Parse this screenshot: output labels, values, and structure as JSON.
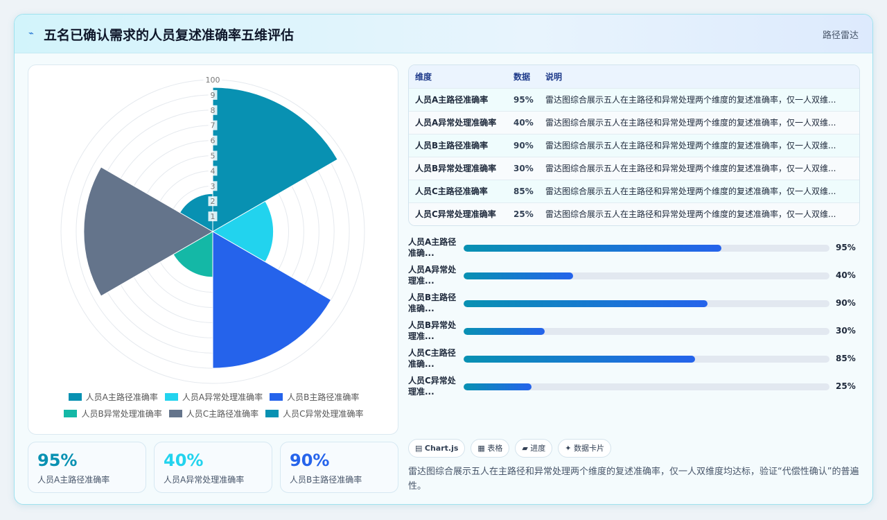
{
  "header": {
    "icon": "chart-icon",
    "title": "五名已确认需求的人员复述准确率五维评估",
    "tag": "路径雷达"
  },
  "chart_data": {
    "type": "polar-area",
    "title": "",
    "categories": [
      "人员A主路径准确率",
      "人员A异常处理准确率",
      "人员B主路径准确率",
      "人员B异常处理准确率",
      "人员C主路径准确率",
      "人员C异常处理准确率"
    ],
    "values": [
      95,
      40,
      90,
      30,
      85,
      25
    ],
    "colors": [
      "#0891b2",
      "#22d3ee",
      "#2563eb",
      "#14b8a6",
      "#64748b",
      "#0891b2"
    ],
    "rlim": [
      0,
      100
    ],
    "ticks": [
      10,
      20,
      30,
      40,
      50,
      60,
      70,
      80,
      90,
      100
    ],
    "tick_labels": [
      "1",
      "2",
      "3",
      "4",
      "5",
      "6",
      "7",
      "8",
      "9",
      "100"
    ],
    "legend_position": "bottom",
    "grid": true
  },
  "kpis": [
    {
      "value": "95%",
      "label": "人员A主路径准确率",
      "color": "#0891b2"
    },
    {
      "value": "40%",
      "label": "人员A异常处理准确率",
      "color": "#22d3ee"
    },
    {
      "value": "90%",
      "label": "人员B主路径准确率",
      "color": "#2563eb"
    }
  ],
  "table": {
    "headers": [
      "维度",
      "数据",
      "说明"
    ],
    "rows": [
      {
        "dim": "人员A主路径准确率",
        "val": "95%",
        "note": "雷达图综合展示五人在主路径和异常处理两个维度的复述准确率，仅一人双维..."
      },
      {
        "dim": "人员A异常处理准确率",
        "val": "40%",
        "note": "雷达图综合展示五人在主路径和异常处理两个维度的复述准确率，仅一人双维..."
      },
      {
        "dim": "人员B主路径准确率",
        "val": "90%",
        "note": "雷达图综合展示五人在主路径和异常处理两个维度的复述准确率，仅一人双维..."
      },
      {
        "dim": "人员B异常处理准确率",
        "val": "30%",
        "note": "雷达图综合展示五人在主路径和异常处理两个维度的复述准确率，仅一人双维..."
      },
      {
        "dim": "人员C主路径准确率",
        "val": "85%",
        "note": "雷达图综合展示五人在主路径和异常处理两个维度的复述准确率，仅一人双维..."
      },
      {
        "dim": "人员C异常处理准确率",
        "val": "25%",
        "note": "雷达图综合展示五人在主路径和异常处理两个维度的复述准确率，仅一人双维..."
      }
    ]
  },
  "progress": [
    {
      "label1": "人员A主路径",
      "label2": "准确...",
      "value": 95,
      "text": "95%"
    },
    {
      "label1": "人员A异常处",
      "label2": "理准...",
      "value": 40,
      "text": "40%"
    },
    {
      "label1": "人员B主路径",
      "label2": "准确...",
      "value": 90,
      "text": "90%"
    },
    {
      "label1": "人员B异常处",
      "label2": "理准...",
      "value": 30,
      "text": "30%"
    },
    {
      "label1": "人员C主路径",
      "label2": "准确...",
      "value": 85,
      "text": "85%"
    },
    {
      "label1": "人员C异常处",
      "label2": "理准...",
      "value": 25,
      "text": "25%"
    }
  ],
  "chips": [
    {
      "icon": "▤",
      "label": "Chart.js",
      "bold": true
    },
    {
      "icon": "▦",
      "label": "表格",
      "bold": false
    },
    {
      "icon": "▰",
      "label": "进度",
      "bold": false
    },
    {
      "icon": "✦",
      "label": "数据卡片",
      "bold": false
    }
  ],
  "description": "雷达图综合展示五人在主路径和异常处理两个维度的复述准确率，仅一人双维度均达标，验证“代偿性确认”的普遍性。"
}
